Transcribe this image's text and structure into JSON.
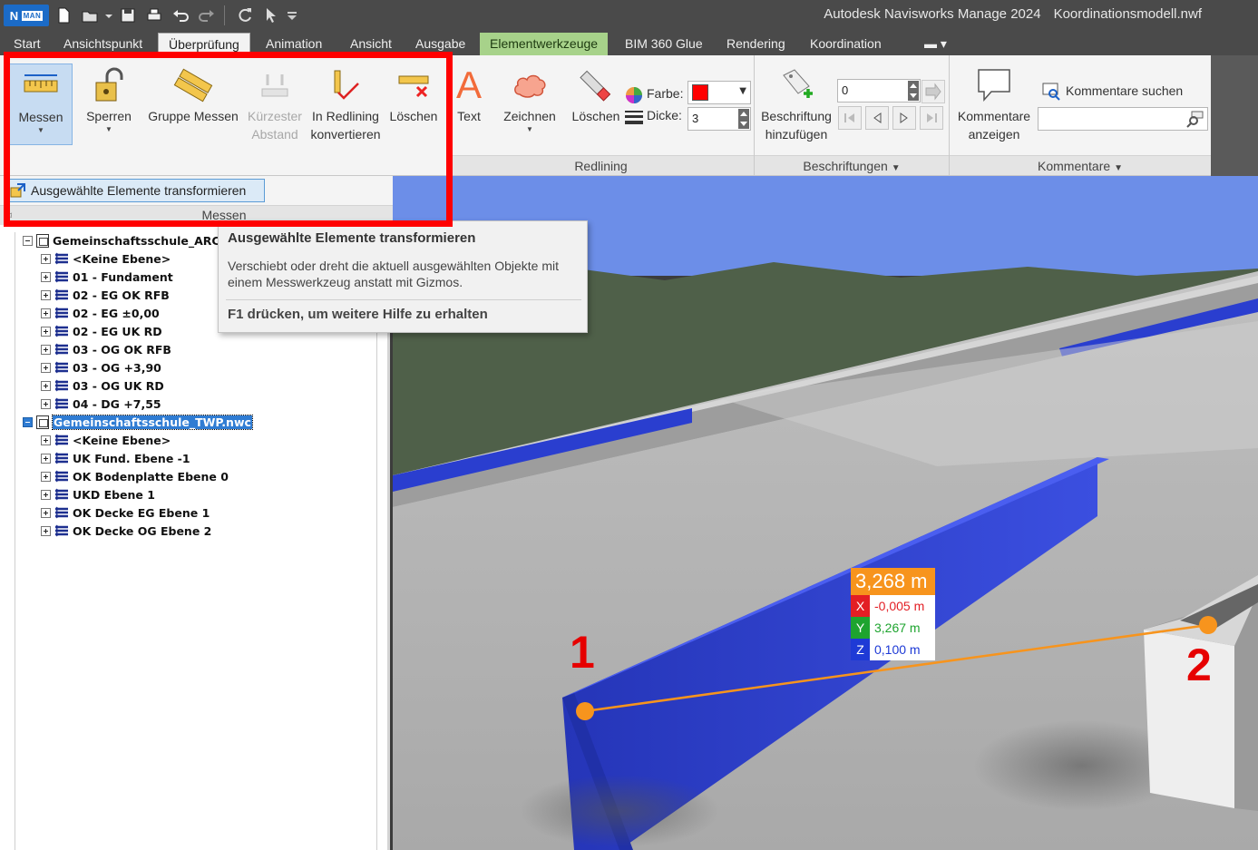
{
  "app": {
    "title": "Autodesk Navisworks Manage 2024",
    "file": "Koordinationsmodell.nwf",
    "logo_text": "N",
    "logo_badge": "MAN"
  },
  "tabs": [
    {
      "label": "Start"
    },
    {
      "label": "Ansichtspunkt"
    },
    {
      "label": "Überprüfung",
      "active": true
    },
    {
      "label": "Animation"
    },
    {
      "label": "Ansicht"
    },
    {
      "label": "Ausgabe"
    },
    {
      "label": "Elementwerkzeuge",
      "contextual": true
    },
    {
      "label": "BIM 360 Glue"
    },
    {
      "label": "Rendering"
    },
    {
      "label": "Koordination"
    }
  ],
  "ribbon": {
    "measure": {
      "messen": "Messen",
      "sperren": "Sperren",
      "gruppe_messen": "Gruppe Messen",
      "kuerzester": "Kürzester",
      "abstand": "Abstand",
      "in_redlining": "In Redlining",
      "konvertieren": "konvertieren",
      "loeschen": "Löschen",
      "transform": "Ausgewählte Elemente transformieren",
      "panel": "Messen"
    },
    "redlining": {
      "text": "Text",
      "zeichnen": "Zeichnen",
      "loeschen": "Löschen",
      "farbe_label": "Farbe:",
      "dicke_label": "Dicke:",
      "dicke_value": "3",
      "color": "#ff0000",
      "panel": "Redlining"
    },
    "beschriftungen": {
      "line1": "Beschriftung",
      "line2": "hinzufügen",
      "value": "0",
      "panel": "Beschriftungen"
    },
    "kommentare": {
      "line1": "Kommentare",
      "line2": "anzeigen",
      "search": "Kommentare suchen",
      "panel": "Kommentare"
    }
  },
  "tooltip": {
    "title": "Ausgewählte Elemente transformieren",
    "description": "Verschiebt oder dreht die aktuell ausgewählten Objekte mit einem Messwerkzeug anstatt mit Gizmos.",
    "help": "F1 drücken, um weitere Hilfe zu erhalten"
  },
  "tree": {
    "file1": "Gemeinschaftsschule_ARCH",
    "file1_levels": [
      "<Keine Ebene>",
      "01 - Fundament",
      "02 - EG OK RFB",
      "02 - EG ±0,00",
      "02 - EG UK RD",
      "03 - OG OK RFB",
      "03 - OG +3,90",
      "03 - OG UK RD",
      "04 - DG +7,55"
    ],
    "file2": "Gemeinschaftsschule_TWP.nwc",
    "file2_levels": [
      "<Keine Ebene>",
      "UK Fund. Ebene -1",
      "OK Bodenplatte Ebene 0",
      "UKD Ebene 1",
      "OK Decke EG Ebene 1",
      "OK Decke OG Ebene 2"
    ]
  },
  "measurement": {
    "total": "3,268 m",
    "x_label": "X",
    "x": "-0,005 m",
    "y_label": "Y",
    "y": "3,267 m",
    "z_label": "Z",
    "z": "0,100 m",
    "point1": "1",
    "point2": "2"
  },
  "colors": {
    "accent_red": "#ff0000",
    "measure_orange": "#f7941d",
    "x_axis": "#e31e24",
    "y_axis": "#1ea42f",
    "z_axis": "#1e3ad6",
    "sky": "#6c8ee8",
    "terrain": "#4f6049",
    "blue_element": "#2a3ecf"
  }
}
